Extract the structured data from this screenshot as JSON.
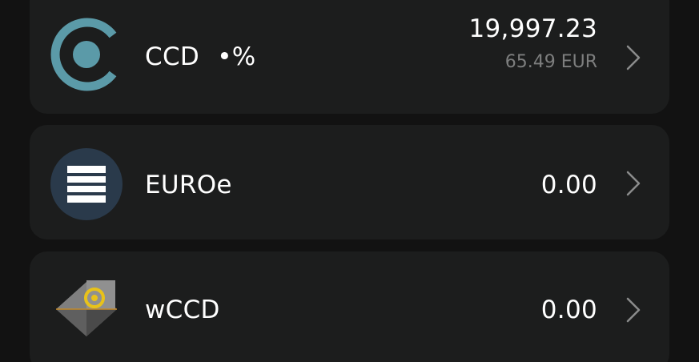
{
  "tokens": [
    {
      "name": "CCD",
      "badge": "•%",
      "amount": "19,997.23",
      "fiat": "65.49 EUR",
      "icon": "concordium-logo-icon"
    },
    {
      "name": "EUROe",
      "amount": "0.00",
      "icon": "euroe-logo-icon"
    },
    {
      "name": "wCCD",
      "amount": "0.00",
      "icon": "wccd-logo-icon"
    }
  ],
  "colors": {
    "background": "#121212",
    "card": "#1c1d1d",
    "text": "#ffffff",
    "muted": "#7d7e7e",
    "ccd_accent": "#5b9aa8",
    "euroe_bg": "#2a3a4b"
  }
}
